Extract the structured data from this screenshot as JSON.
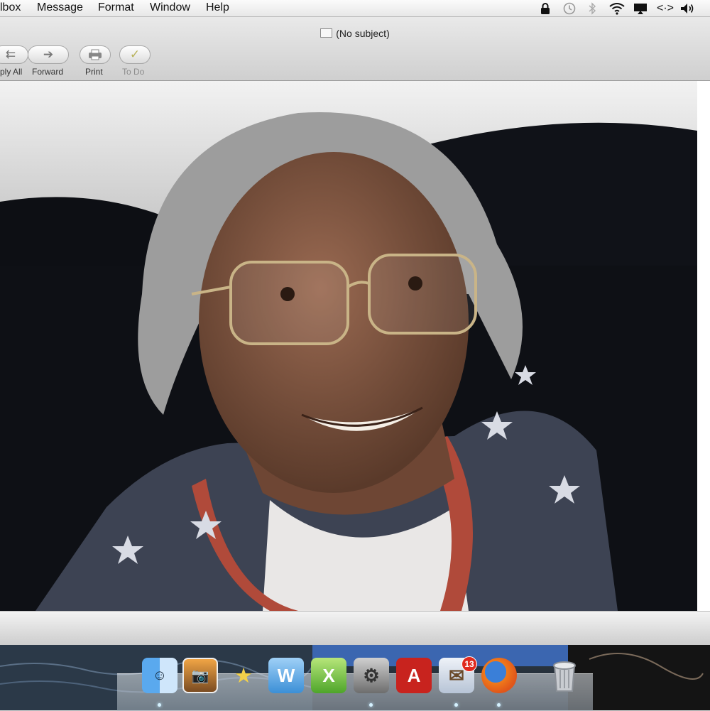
{
  "menubar": {
    "items": [
      "lbox",
      "Message",
      "Format",
      "Window",
      "Help"
    ],
    "status_icons": [
      "lock-icon",
      "time-machine-icon",
      "bluetooth-icon",
      "wifi-icon",
      "airplay-icon",
      "code-icon",
      "volume-icon"
    ]
  },
  "window": {
    "title": "(No subject)"
  },
  "toolbar": {
    "reply_all_label": "ply All",
    "forward_label": "Forward",
    "print_label": "Print",
    "todo_label": "To Do"
  },
  "message": {
    "image_subject": "Smiling older man with glasses wearing star-print shirt"
  },
  "dock": {
    "apps": [
      "Finder",
      "iPhoto",
      "iMovie",
      "Word",
      "Excel",
      "System Preferences",
      "Adobe Reader",
      "Mail",
      "Firefox",
      "Trash"
    ],
    "mail_badge": "13"
  },
  "colors": {
    "menubar_bg": "#efefef",
    "window_bg": "#d9d9d9",
    "badge": "#e0291e",
    "acrobat_red": "#c8231e"
  }
}
